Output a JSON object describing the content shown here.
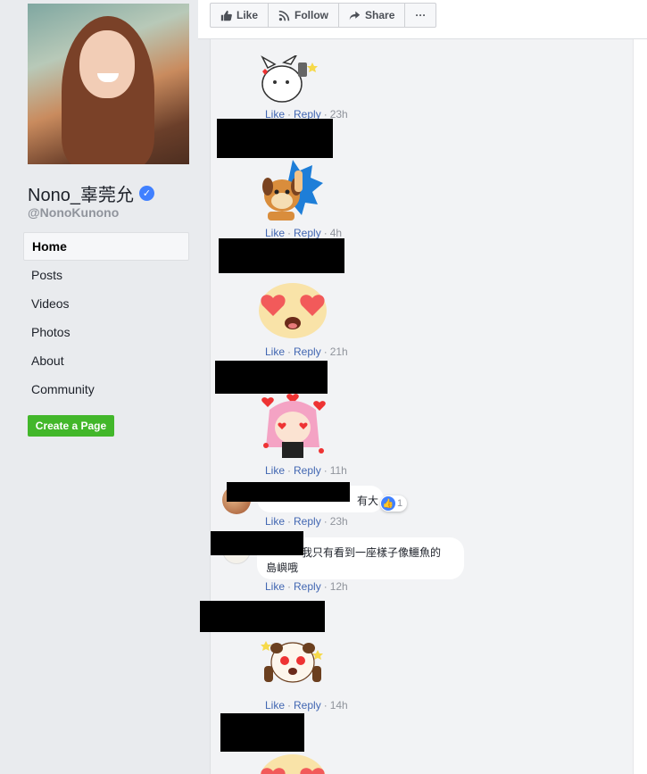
{
  "profile": {
    "name": "Nono_辜莞允",
    "handle": "@NonoKunono"
  },
  "nav": {
    "items": [
      {
        "label": "Home",
        "active": true
      },
      {
        "label": "Posts"
      },
      {
        "label": "Videos"
      },
      {
        "label": "Photos"
      },
      {
        "label": "About"
      },
      {
        "label": "Community"
      }
    ],
    "create_page_label": "Create a Page"
  },
  "actions": {
    "like": "Like",
    "follow": "Follow",
    "share": "Share",
    "more": "···"
  },
  "comment_actions": {
    "like": "Like",
    "reply": "Reply",
    "sep": "·"
  },
  "comments": [
    {
      "time": "23h"
    },
    {
      "time": "4h"
    },
    {
      "time": "21h"
    },
    {
      "time": "11h"
    },
    {
      "text": "有大",
      "time": "23h",
      "reactions": "1"
    },
    {
      "text_line1": "我只有看到一座樣子像鱷魚的",
      "text_line2": "島嶼哦",
      "time": "12h"
    },
    {
      "time": "14h"
    }
  ],
  "colors": {
    "link": "#4267b2",
    "meta": "#90949c",
    "create_button": "#42b72a",
    "verified": "#4080ff"
  }
}
